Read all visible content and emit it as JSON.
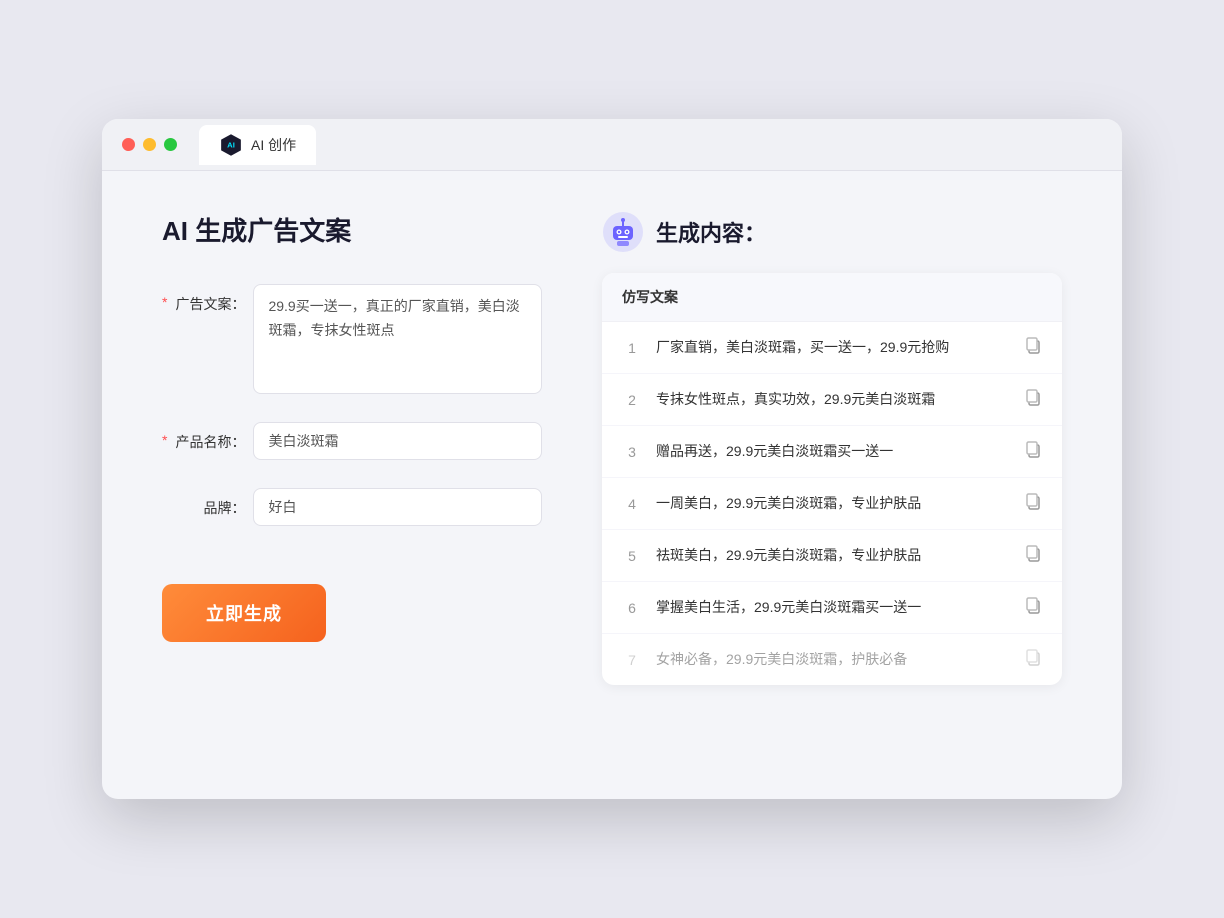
{
  "window": {
    "tab_label": "AI 创作"
  },
  "left_panel": {
    "title": "AI 生成广告文案",
    "form": {
      "ad_copy": {
        "label": "广告文案：",
        "required": true,
        "value": "29.9买一送一，真正的厂家直销，美白淡斑霜，专抹女性斑点"
      },
      "product_name": {
        "label": "产品名称：",
        "required": true,
        "value": "美白淡斑霜"
      },
      "brand": {
        "label": "品牌：",
        "required": false,
        "value": "好白"
      }
    },
    "generate_button": "立即生成"
  },
  "right_panel": {
    "title": "生成内容：",
    "column_header": "仿写文案",
    "results": [
      {
        "number": 1,
        "text": "厂家直销，美白淡斑霜，买一送一，29.9元抢购",
        "dimmed": false
      },
      {
        "number": 2,
        "text": "专抹女性斑点，真实功效，29.9元美白淡斑霜",
        "dimmed": false
      },
      {
        "number": 3,
        "text": "赠品再送，29.9元美白淡斑霜买一送一",
        "dimmed": false
      },
      {
        "number": 4,
        "text": "一周美白，29.9元美白淡斑霜，专业护肤品",
        "dimmed": false
      },
      {
        "number": 5,
        "text": "祛斑美白，29.9元美白淡斑霜，专业护肤品",
        "dimmed": false
      },
      {
        "number": 6,
        "text": "掌握美白生活，29.9元美白淡斑霜买一送一",
        "dimmed": false
      },
      {
        "number": 7,
        "text": "女神必备，29.9元美白淡斑霜，护肤必备",
        "dimmed": true
      }
    ]
  }
}
